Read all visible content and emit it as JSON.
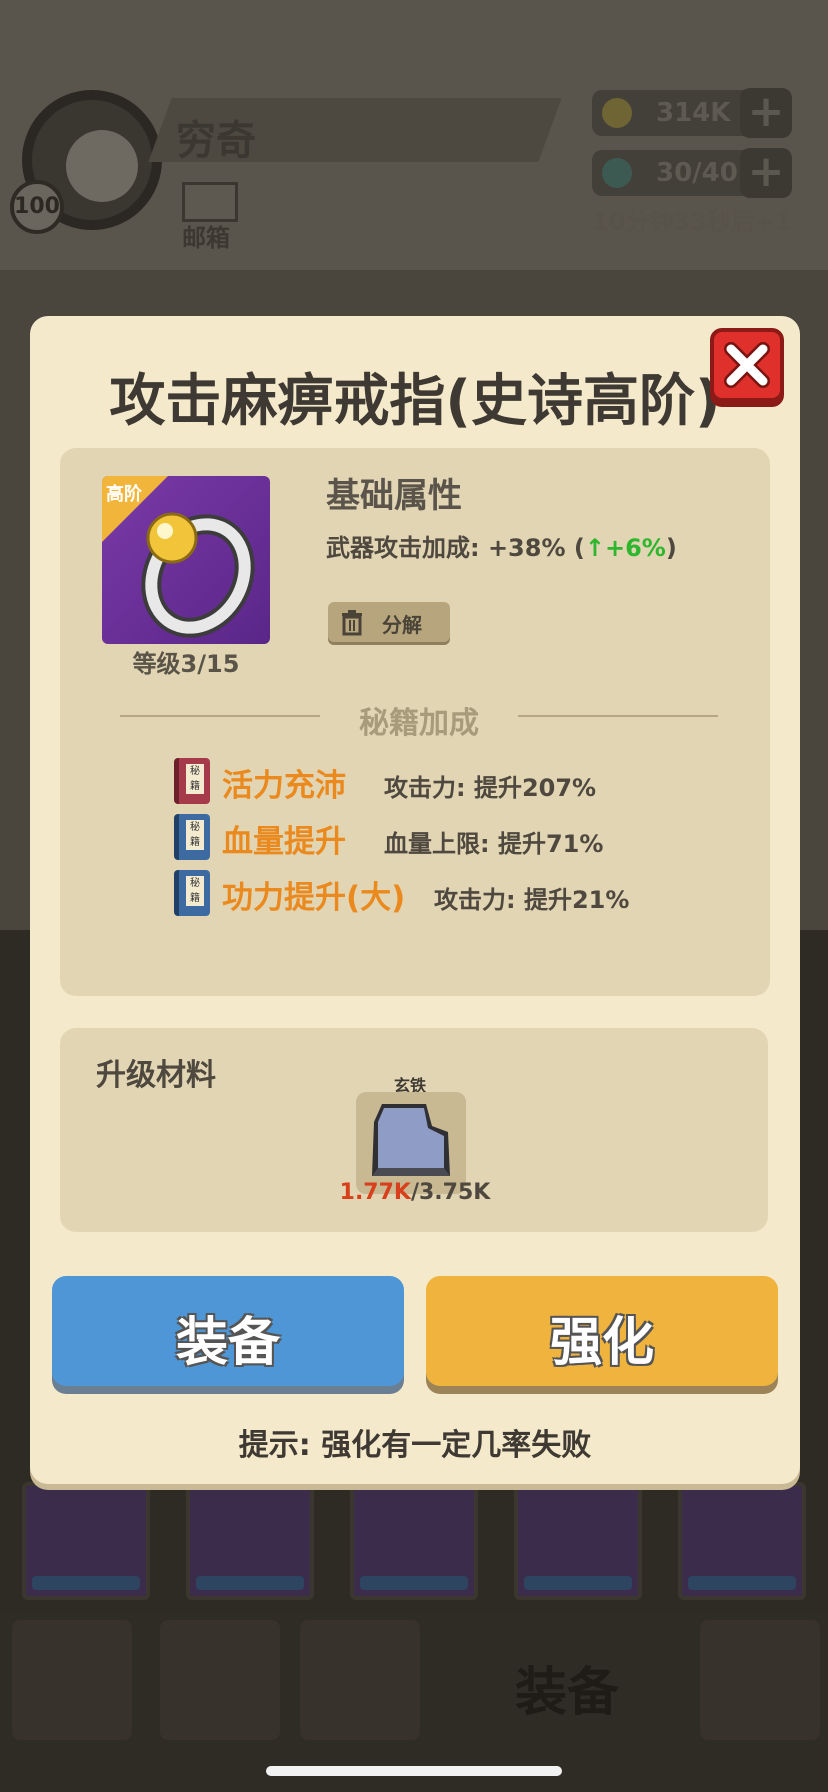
{
  "player": {
    "name": "穷奇",
    "level": "100",
    "mail_label": "邮箱"
  },
  "resources": {
    "gold": "314K",
    "stamina": "30/40",
    "timer": "10分钟33秒后+1"
  },
  "nav": {
    "active_label": "装备"
  },
  "item": {
    "title": "攻击麻痹戒指(史诗高阶)",
    "tier_badge": "高阶",
    "level": "等级3/15",
    "icon": "ring-icon"
  },
  "attributes": {
    "title": "基础属性",
    "line_prefix": "武器攻击加成: +38% (",
    "line_up": "↑+6%",
    "line_suffix": ")"
  },
  "decompose_label": "分解",
  "secrets": {
    "title": "秘籍加成",
    "book_tag": "秘籍",
    "items": [
      {
        "name": "活力充沛",
        "effect": "攻击力: 提升207%",
        "book_color": "red"
      },
      {
        "name": "血量提升",
        "effect": "血量上限: 提升71%",
        "book_color": "blue"
      },
      {
        "name": "功力提升(大)",
        "effect": "攻击力: 提升21%",
        "book_color": "blue"
      }
    ]
  },
  "materials": {
    "title": "升级材料",
    "item_name": "玄铁",
    "have": "1.77K",
    "need": "/3.75K"
  },
  "buttons": {
    "equip": "装备",
    "enhance": "强化"
  },
  "hint": "提示: 强化有一定几率失败",
  "colors": {
    "modal_bg": "#f5e9cb",
    "equip_blue": "#4f96d6",
    "enhance_yellow": "#efb33e",
    "skill_orange": "#ea8a1e",
    "close_red": "#e0302c"
  }
}
